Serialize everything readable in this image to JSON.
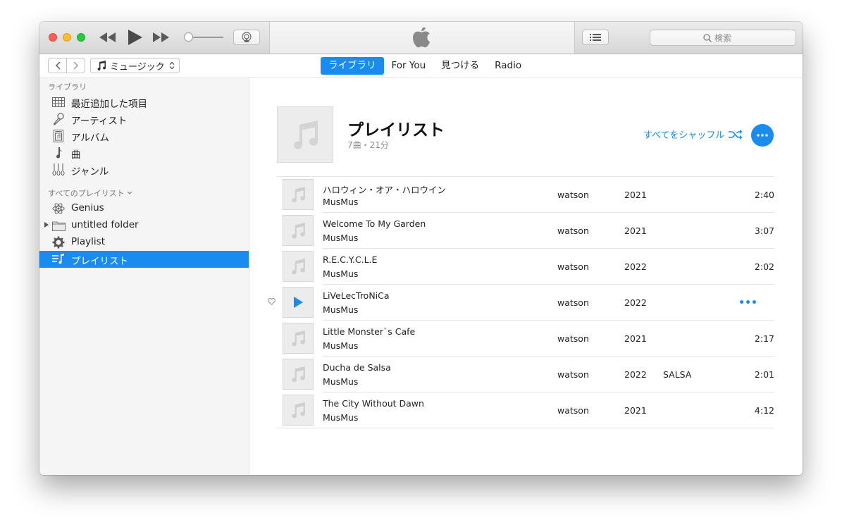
{
  "toolbar": {
    "search_placeholder": "検索"
  },
  "nav": {
    "media_kind": "ミュージック",
    "tabs": [
      {
        "label": "ライブラリ",
        "active": true
      },
      {
        "label": "For You",
        "active": false
      },
      {
        "label": "見つける",
        "active": false
      },
      {
        "label": "Radio",
        "active": false
      }
    ]
  },
  "sidebar": {
    "library_title": "ライブラリ",
    "library_items": [
      {
        "label": "最近追加した項目",
        "icon": "recently-added-icon"
      },
      {
        "label": "アーティスト",
        "icon": "microphone-icon"
      },
      {
        "label": "アルバム",
        "icon": "album-icon"
      },
      {
        "label": "曲",
        "icon": "music-note-icon"
      },
      {
        "label": "ジャンル",
        "icon": "guitars-icon"
      }
    ],
    "playlists_title": "すべてのプレイリスト",
    "playlist_items": [
      {
        "label": "Genius",
        "icon": "genius-atom-icon"
      },
      {
        "label": "untitled folder",
        "icon": "folder-icon"
      },
      {
        "label": "Playlist",
        "icon": "smart-playlist-gear-icon"
      },
      {
        "label": "プレイリスト",
        "icon": "playlist-icon",
        "selected": true
      }
    ]
  },
  "playlist": {
    "title": "プレイリスト",
    "subtitle": "7曲・21分",
    "shuffle_label": "すべてをシャッフル"
  },
  "tracks": [
    {
      "name": "ハロウィン・オア・ハロウイン",
      "artist": "MusMus",
      "album": "watson",
      "year": "2021",
      "genre": "",
      "duration": "2:40"
    },
    {
      "name": "Welcome To My Garden",
      "artist": "MusMus",
      "album": "watson",
      "year": "2021",
      "genre": "",
      "duration": "3:07"
    },
    {
      "name": "R.E.C.Y.C.L.E",
      "artist": "MusMus",
      "album": "watson",
      "year": "2022",
      "genre": "",
      "duration": "2:02"
    },
    {
      "name": "LiVeLecTroNiCa",
      "artist": "MusMus",
      "album": "watson",
      "year": "2022",
      "genre": "",
      "duration": "",
      "hover": true,
      "more_label": "•••"
    },
    {
      "name": "Little Monster`s Cafe",
      "artist": "MusMus",
      "album": "watson",
      "year": "2021",
      "genre": "",
      "duration": "2:17"
    },
    {
      "name": "Ducha de Salsa",
      "artist": "MusMus",
      "album": "watson",
      "year": "2022",
      "genre": "SALSA",
      "duration": "2:01"
    },
    {
      "name": "The City Without Dawn",
      "artist": "MusMus",
      "album": "watson",
      "year": "2021",
      "genre": "",
      "duration": "4:12"
    }
  ],
  "colors": {
    "accent": "#1a8cf0",
    "sidebar_bg": "#f5f5f5"
  }
}
